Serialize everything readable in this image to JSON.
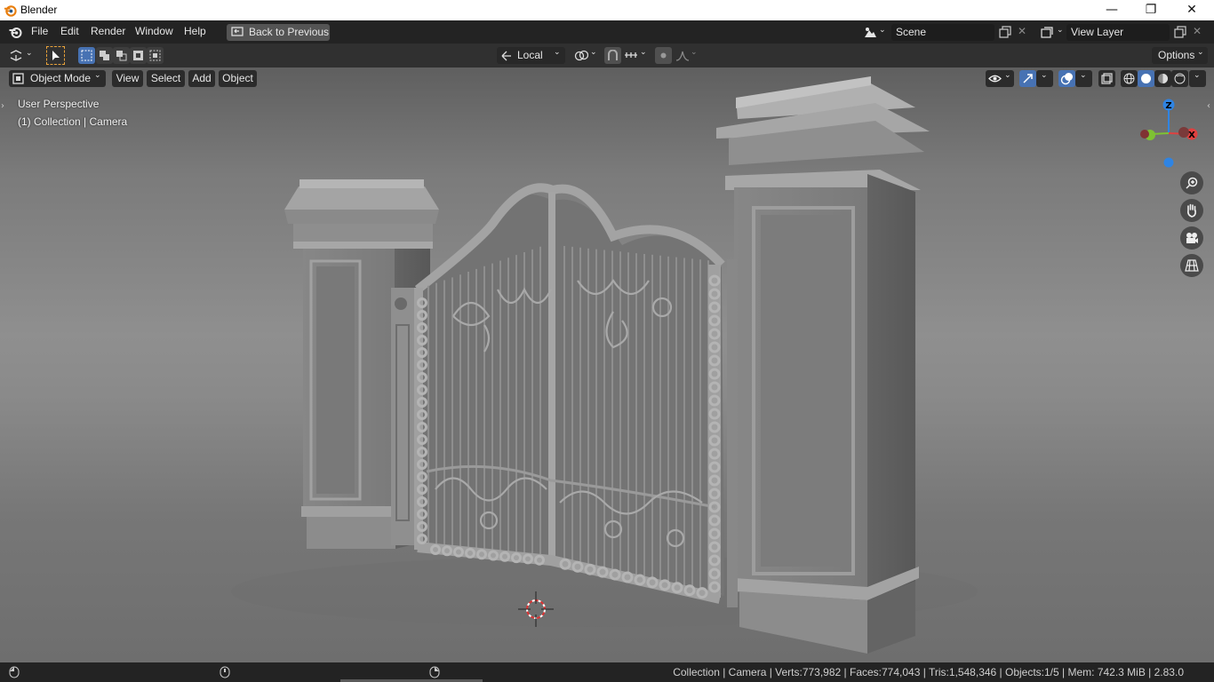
{
  "window": {
    "title": "Blender",
    "minimize": "—",
    "restore": "❐",
    "close": "✕"
  },
  "menubar": {
    "items": [
      "File",
      "Edit",
      "Render",
      "Window",
      "Help"
    ],
    "back_button": "Back to Previous",
    "scene": "Scene",
    "view_layer": "View Layer"
  },
  "toolheader": {
    "transform_orientation": "Local",
    "options": "Options"
  },
  "viewport_header": {
    "mode": "Object Mode",
    "menus": [
      "View",
      "Select",
      "Add",
      "Object"
    ]
  },
  "overlay_text": {
    "perspective": "User Perspective",
    "collection": "(1) Collection | Camera"
  },
  "gizmo": {
    "z": "Z",
    "x": "X"
  },
  "statusbar": {
    "stats": "Collection | Camera | Verts:773,982 | Faces:774,043 | Tris:1,548,346 | Objects:1/5 | Mem: 742.3 MiB | 2.83.0"
  },
  "colors": {
    "accent": "#4772b3",
    "axis_x": "#e0403f",
    "axis_y": "#7ec232",
    "axis_z": "#2f84e3"
  }
}
